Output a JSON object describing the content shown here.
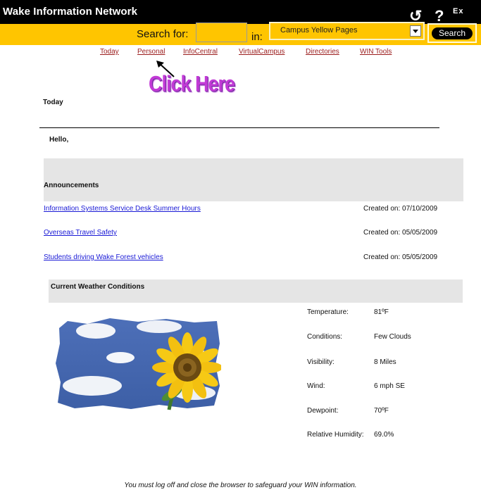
{
  "header": {
    "title": "Wake Information Network",
    "icons": {
      "refresh": "↺",
      "help": "?",
      "exit": "Ex"
    }
  },
  "search": {
    "label": "Search for:",
    "input_value": "",
    "in_label": "in:",
    "scope_selected": "Campus Yellow Pages",
    "button_label": "Search"
  },
  "nav": {
    "items": [
      "Today",
      "Personal",
      "InfoCentral",
      "VirtualCampus",
      "Directories",
      "WIN Tools"
    ]
  },
  "callout": {
    "text": "Click Here"
  },
  "main": {
    "page_heading": "Today",
    "greeting": "Hello,",
    "announcements_title": "Announcements",
    "announcements": [
      {
        "title": "Information Systems Service Desk Summer Hours",
        "created": "Created on: 07/10/2009"
      },
      {
        "title": "Overseas Travel Safety",
        "created": "Created on: 05/05/2009"
      },
      {
        "title": "Students driving Wake Forest vehicles",
        "created": "Created on: 05/05/2009"
      }
    ]
  },
  "weather": {
    "title": "Current Weather Conditions",
    "rows": [
      {
        "label": "Temperature:",
        "value": "81ºF"
      },
      {
        "label": "Conditions:",
        "value": "Few Clouds"
      },
      {
        "label": "Visibility:",
        "value": "8 Miles"
      },
      {
        "label": "Wind:",
        "value": "6 mph SE"
      },
      {
        "label": "Dewpoint:",
        "value": "70ºF"
      },
      {
        "label": "Relative Humidity:",
        "value": "69.0%"
      }
    ]
  },
  "footer": {
    "note": "You must log off and close the browser to safeguard your WIN information."
  },
  "colors": {
    "header_bg": "#000000",
    "search_bar_bg": "#ffc500",
    "nav_link": "#9b1c1c",
    "announcement_link": "#1a1ad6",
    "band_gray": "#e5e5e5",
    "callout": "#c23ad6"
  }
}
